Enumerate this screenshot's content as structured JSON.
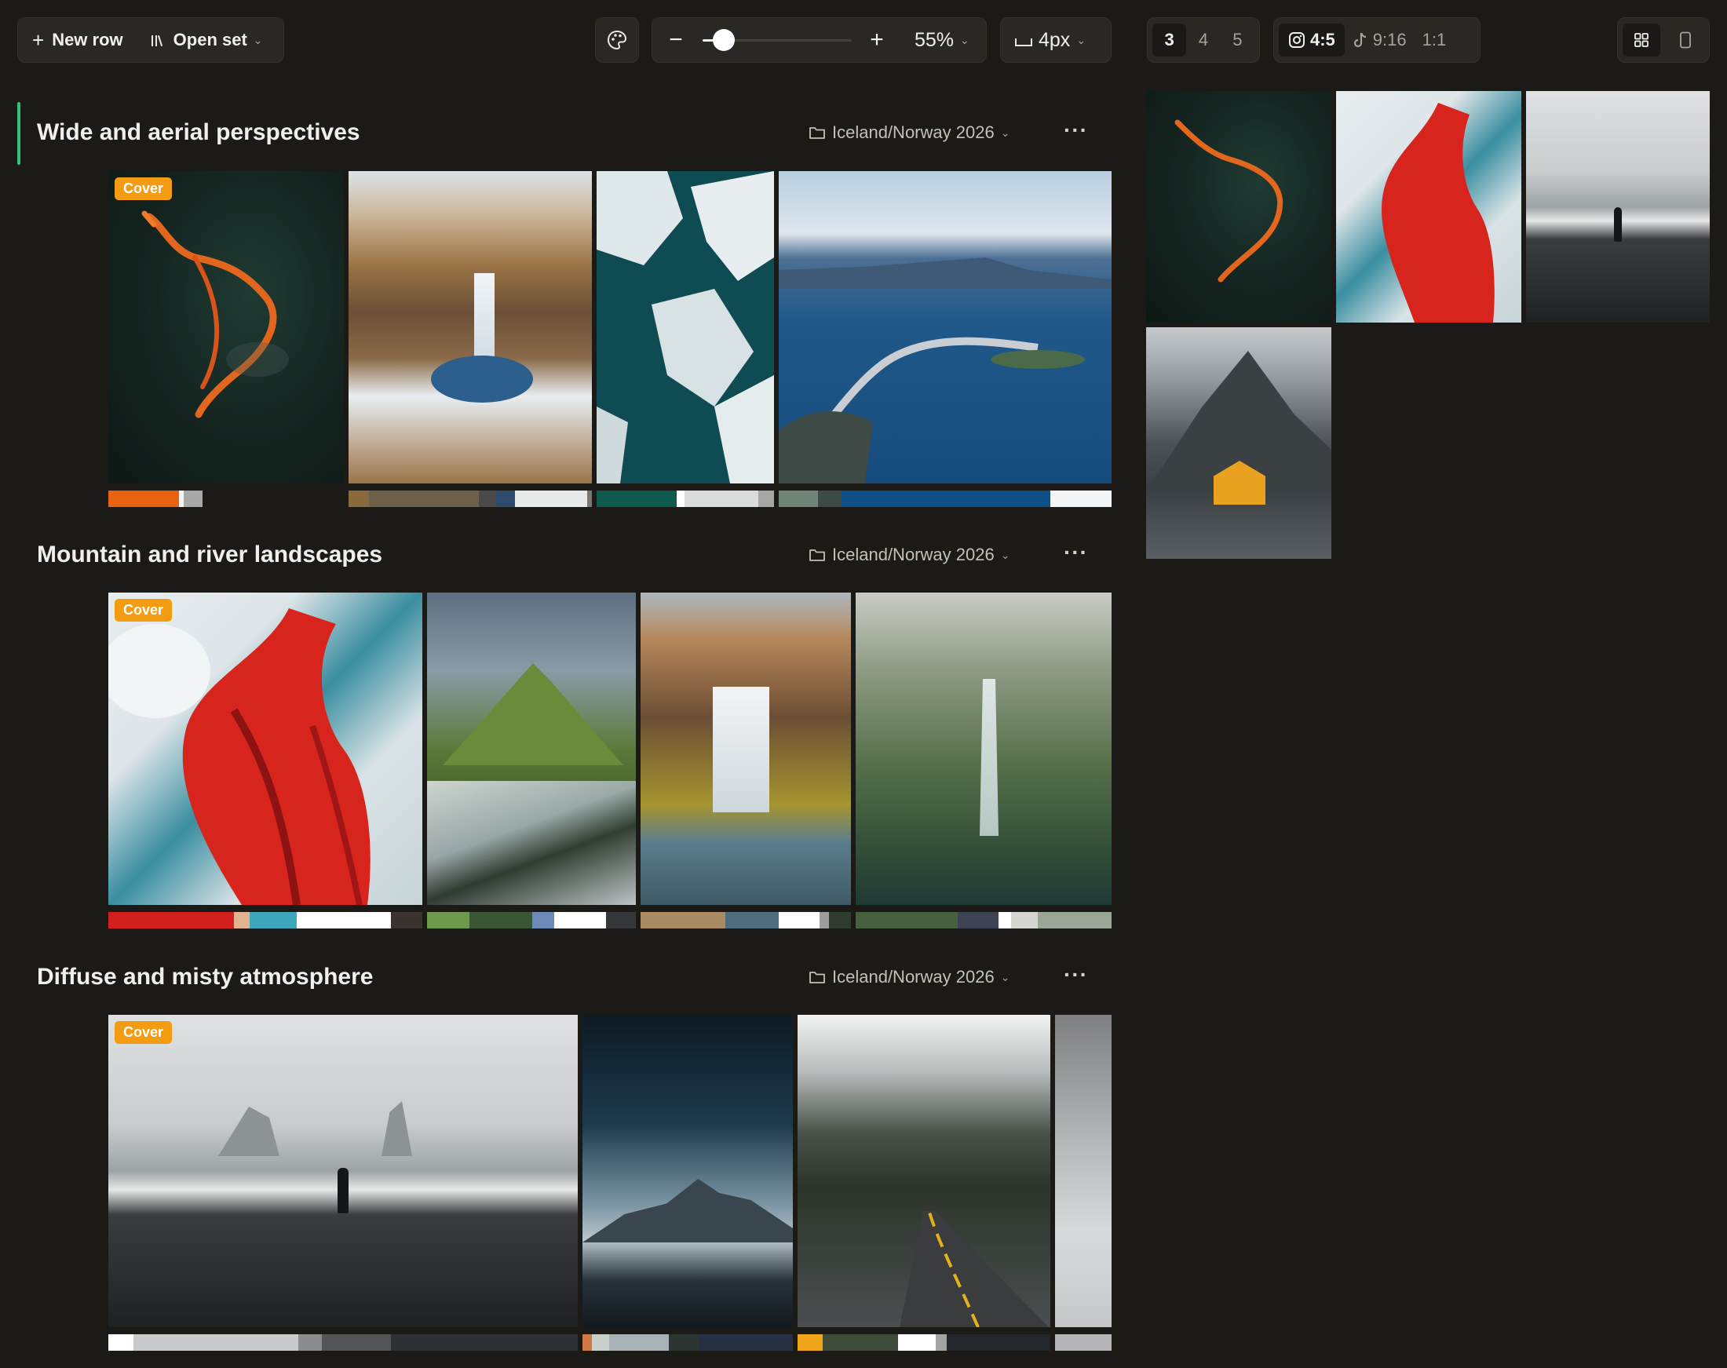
{
  "toolbar": {
    "new_row": "New row",
    "open_set": "Open set",
    "zoom_value": "55%",
    "zoom_level": 0.08,
    "gap_value": "4px",
    "columns": [
      "3",
      "4",
      "5"
    ],
    "ratio_instagram": "4:5",
    "ratio_tiktok": "9:16",
    "ratio_square": "1:1"
  },
  "rows": [
    {
      "title": "Wide and aerial perspectives",
      "folder": "Iceland/Norway 2026",
      "cover_label": "Cover"
    },
    {
      "title": "Mountain and river landscapes",
      "folder": "Iceland/Norway 2026",
      "cover_label": "Cover"
    },
    {
      "title": "Diffuse and misty atmosphere",
      "folder": "Iceland/Norway 2026",
      "cover_label": "Cover"
    }
  ],
  "colors": {
    "accent": "#2ec27e",
    "cover": "#f39c12",
    "background": "#1c1a17",
    "panel": "#2a2825"
  },
  "icons": [
    "plus-icon",
    "library-icon",
    "palette-icon",
    "minus-icon",
    "folder-icon",
    "more-icon",
    "instagram-icon",
    "tiktok-icon",
    "grid-icon",
    "phone-icon"
  ]
}
